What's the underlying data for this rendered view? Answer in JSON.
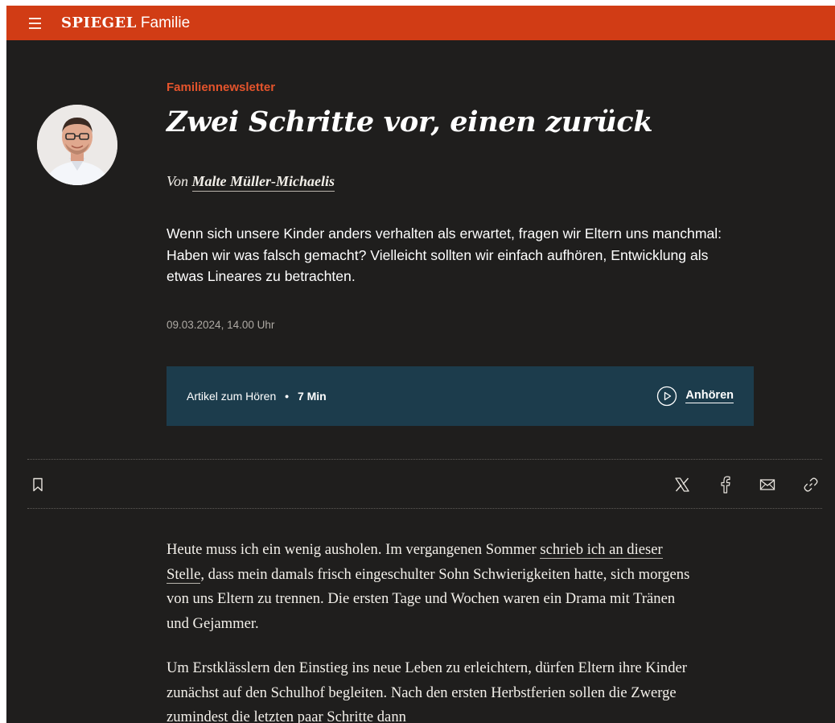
{
  "header": {
    "menu_icon": "hamburger-icon",
    "brand": "SPIEGEL",
    "section": "Familie",
    "background": "#d13c15"
  },
  "article": {
    "kicker": "Familiennewsletter",
    "headline": "Zwei Schritte vor, einen zurück",
    "byline_prefix": "Von",
    "author": "Malte Müller-Michaelis",
    "teaser": "Wenn sich unsere Kinder anders verhalten als erwartet, fragen wir Eltern uns manchmal: Haben wir was falsch gemacht? Vielleicht sollten wir einfach aufhören, Entwicklung als etwas Lineares zu betrachten.",
    "date": "09.03.2024, 14.00 Uhr"
  },
  "audio": {
    "label": "Artikel zum Hören",
    "separator": "•",
    "duration": "7 Min",
    "play_icon": "play-circle-icon",
    "listen_label": "Anhören",
    "background": "#1c3c4c"
  },
  "toolbar": {
    "bookmark_icon": "bookmark-icon",
    "share_icons": [
      "x-icon",
      "facebook-icon",
      "mail-icon",
      "link-icon"
    ]
  },
  "body": {
    "p1_before": "Heute muss ich ein wenig ausholen. Im vergangenen Sommer ",
    "p1_link": "schrieb ich an dieser Stelle",
    "p1_after": ", dass mein damals frisch eingeschulter Sohn Schwierigkeiten hatte, sich morgens von uns Eltern zu trennen. Die ersten Tage und Wochen waren ein Drama mit Tränen und Gejammer.",
    "p2": "Um Erstklässlern den Einstieg ins neue Leben zu erleichtern, dürfen Eltern ihre Kinder zunächst auf den Schulhof begleiten. Nach den ersten Herbstferien sollen die Zwerge zumindest die letzten paar Schritte dann"
  }
}
